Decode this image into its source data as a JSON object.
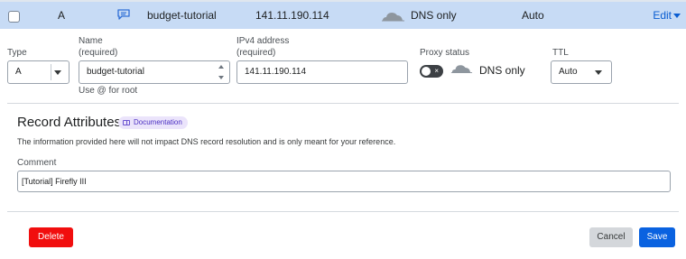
{
  "record_row": {
    "type": "A",
    "name": "budget-tutorial",
    "content": "141.11.190.114",
    "proxy_status": "DNS only",
    "ttl": "Auto",
    "edit_label": "Edit"
  },
  "form": {
    "type": {
      "label": "Type",
      "value": "A"
    },
    "name": {
      "label_line1": "Name",
      "label_line2": "(required)",
      "value": "budget-tutorial",
      "hint": "Use @ for root"
    },
    "ipv4": {
      "label_line1": "IPv4 address",
      "label_line2": "(required)",
      "value": "141.11.190.114"
    },
    "proxy": {
      "label": "Proxy status",
      "toggle_mark": "×",
      "value": "DNS only"
    },
    "ttl": {
      "label": "TTL",
      "value": "Auto"
    }
  },
  "attributes": {
    "title": "Record Attributes",
    "doc_badge": "Documentation",
    "description": "The information provided here will not impact DNS record resolution and is only meant for your reference.",
    "comment_label": "Comment",
    "comment_value": "[Tutorial] Firefly III"
  },
  "actions": {
    "delete": "Delete",
    "cancel": "Cancel",
    "save": "Save"
  },
  "icons": {
    "comment": "comment-icon",
    "cloud": "cloud-icon",
    "documentation": "book-icon"
  },
  "colors": {
    "row_highlight": "#c7dbf5",
    "primary": "#0a62e0",
    "danger": "#f10e0e",
    "badge_bg": "#ebe4fb",
    "badge_text": "#4b2fc2"
  }
}
